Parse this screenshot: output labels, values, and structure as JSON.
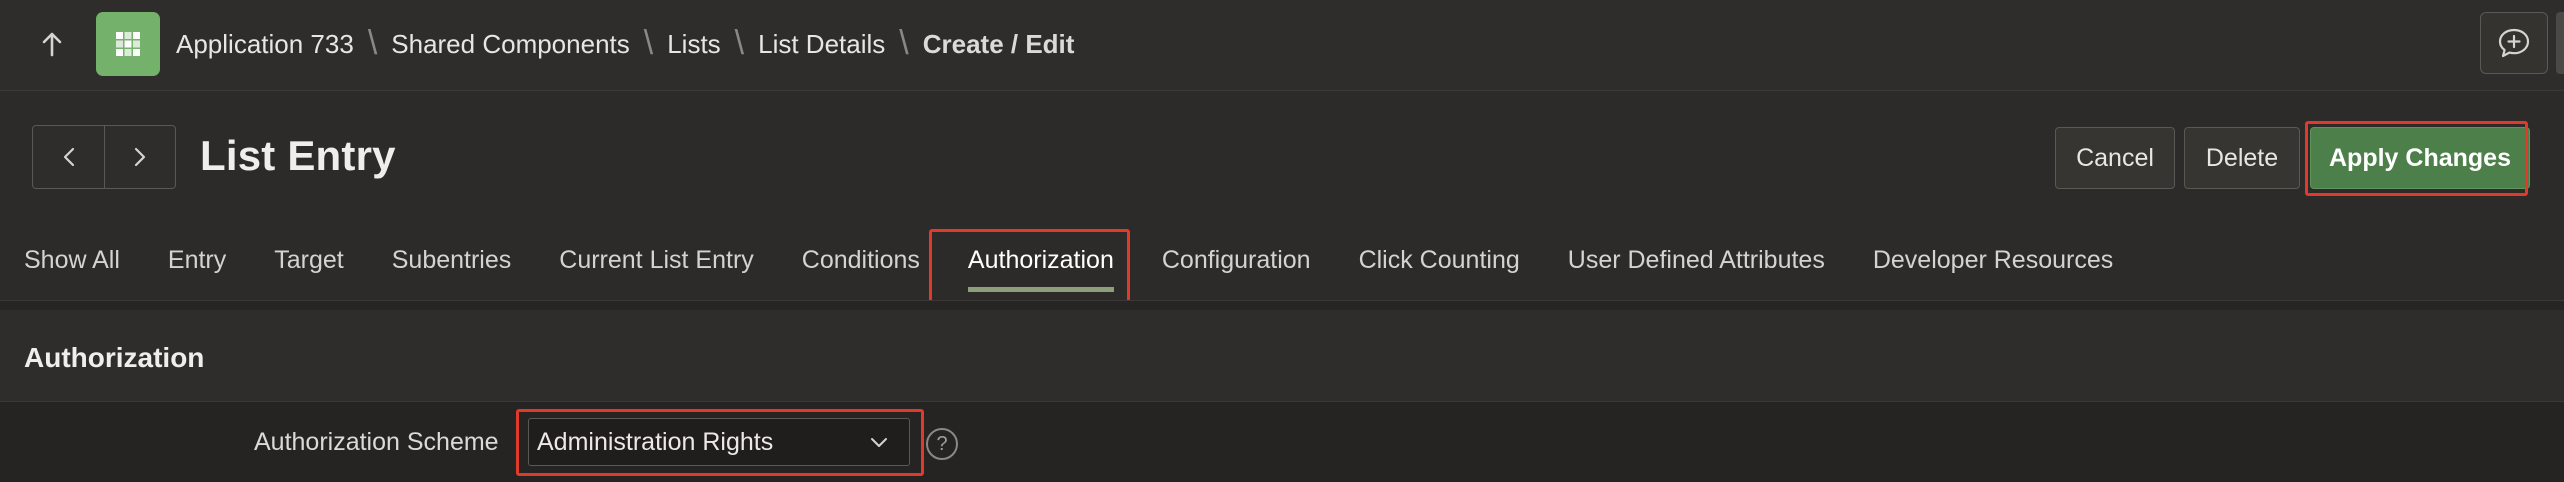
{
  "icons": {
    "up": "arrow-up-icon",
    "app": "app-grid-icon",
    "feedback": "feedback-icon",
    "prev": "chevron-left-icon",
    "next": "chevron-right-icon",
    "dropdown": "chevron-down-icon",
    "help": "question-mark-icon"
  },
  "colors": {
    "accent": "#74b16a",
    "apply": "#4c7f4a",
    "highlight": "#e23a2a",
    "active_tab_underline": "#8a9f7a"
  },
  "breadcrumb": {
    "items": [
      "Application 733",
      "Shared Components",
      "Lists",
      "List Details"
    ],
    "current": "Create / Edit"
  },
  "page": {
    "title": "List Entry"
  },
  "actions": {
    "cancel": "Cancel",
    "delete": "Delete",
    "apply": "Apply Changes"
  },
  "tabs": [
    {
      "label": "Show All"
    },
    {
      "label": "Entry"
    },
    {
      "label": "Target"
    },
    {
      "label": "Subentries"
    },
    {
      "label": "Current List Entry"
    },
    {
      "label": "Conditions"
    },
    {
      "label": "Authorization",
      "active": true
    },
    {
      "label": "Configuration"
    },
    {
      "label": "Click Counting"
    },
    {
      "label": "User Defined Attributes"
    },
    {
      "label": "Developer Resources"
    }
  ],
  "region": {
    "title": "Authorization",
    "field_label": "Authorization Scheme",
    "field_value": "Administration Rights",
    "help_glyph": "?"
  }
}
